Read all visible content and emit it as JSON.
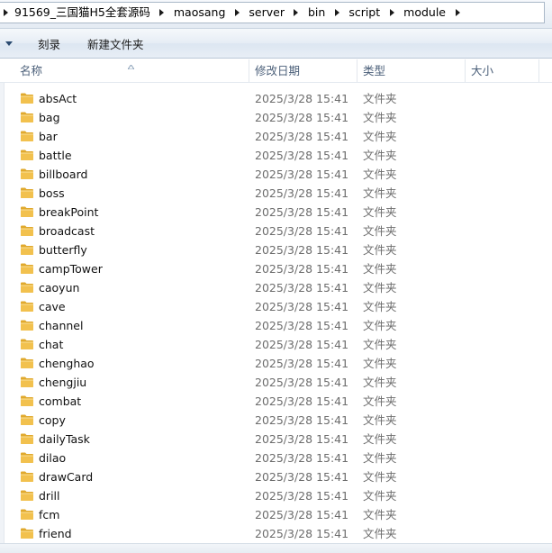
{
  "breadcrumb": {
    "items": [
      "91569_三国猫H5全套源码",
      "maosang",
      "server",
      "bin",
      "script",
      "module"
    ]
  },
  "toolbar": {
    "burn_label": "刻录",
    "new_folder_label": "新建文件夹"
  },
  "columns": {
    "name": "名称",
    "date": "修改日期",
    "type": "类型",
    "size": "大小"
  },
  "files": [
    {
      "name": "absAct",
      "date": "2025/3/28 15:41",
      "type": "文件夹",
      "icon": "folder-icon"
    },
    {
      "name": "bag",
      "date": "2025/3/28 15:41",
      "type": "文件夹",
      "icon": "folder-icon"
    },
    {
      "name": "bar",
      "date": "2025/3/28 15:41",
      "type": "文件夹",
      "icon": "folder-icon"
    },
    {
      "name": "battle",
      "date": "2025/3/28 15:41",
      "type": "文件夹",
      "icon": "folder-icon"
    },
    {
      "name": "billboard",
      "date": "2025/3/28 15:41",
      "type": "文件夹",
      "icon": "folder-icon"
    },
    {
      "name": "boss",
      "date": "2025/3/28 15:41",
      "type": "文件夹",
      "icon": "folder-icon"
    },
    {
      "name": "breakPoint",
      "date": "2025/3/28 15:41",
      "type": "文件夹",
      "icon": "folder-icon"
    },
    {
      "name": "broadcast",
      "date": "2025/3/28 15:41",
      "type": "文件夹",
      "icon": "folder-icon"
    },
    {
      "name": "butterfly",
      "date": "2025/3/28 15:41",
      "type": "文件夹",
      "icon": "folder-icon"
    },
    {
      "name": "campTower",
      "date": "2025/3/28 15:41",
      "type": "文件夹",
      "icon": "folder-icon"
    },
    {
      "name": "caoyun",
      "date": "2025/3/28 15:41",
      "type": "文件夹",
      "icon": "folder-icon"
    },
    {
      "name": "cave",
      "date": "2025/3/28 15:41",
      "type": "文件夹",
      "icon": "folder-icon"
    },
    {
      "name": "channel",
      "date": "2025/3/28 15:41",
      "type": "文件夹",
      "icon": "folder-icon"
    },
    {
      "name": "chat",
      "date": "2025/3/28 15:41",
      "type": "文件夹",
      "icon": "folder-icon"
    },
    {
      "name": "chenghao",
      "date": "2025/3/28 15:41",
      "type": "文件夹",
      "icon": "folder-icon"
    },
    {
      "name": "chengjiu",
      "date": "2025/3/28 15:41",
      "type": "文件夹",
      "icon": "folder-icon"
    },
    {
      "name": "combat",
      "date": "2025/3/28 15:41",
      "type": "文件夹",
      "icon": "folder-icon"
    },
    {
      "name": "copy",
      "date": "2025/3/28 15:41",
      "type": "文件夹",
      "icon": "folder-icon"
    },
    {
      "name": "dailyTask",
      "date": "2025/3/28 15:41",
      "type": "文件夹",
      "icon": "folder-icon"
    },
    {
      "name": "dilao",
      "date": "2025/3/28 15:41",
      "type": "文件夹",
      "icon": "folder-icon"
    },
    {
      "name": "drawCard",
      "date": "2025/3/28 15:41",
      "type": "文件夹",
      "icon": "folder-icon"
    },
    {
      "name": "drill",
      "date": "2025/3/28 15:41",
      "type": "文件夹",
      "icon": "folder-icon"
    },
    {
      "name": "fcm",
      "date": "2025/3/28 15:41",
      "type": "文件夹",
      "icon": "folder-icon"
    },
    {
      "name": "friend",
      "date": "2025/3/28 15:41",
      "type": "文件夹",
      "icon": "folder-icon"
    }
  ],
  "colors": {
    "folder_body": "#f2c14e",
    "folder_tab": "#e0a92d",
    "header_text": "#4c607a",
    "meta_text": "#6d6d6d"
  }
}
